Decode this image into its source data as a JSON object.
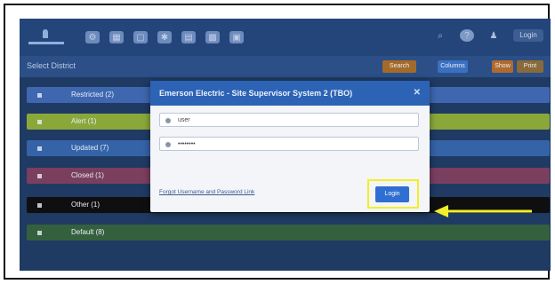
{
  "topbar": {
    "user_label": "Login"
  },
  "subbar": {
    "title": "Select District",
    "buttons": [
      "Search",
      "Columns",
      "Show",
      "Print"
    ]
  },
  "rows": [
    {
      "label": "Restricted (2)",
      "color": "#3e67b0"
    },
    {
      "label": "Alert (1)",
      "color": "#8aa83a"
    },
    {
      "label": "Updated (7)",
      "color": "#3563a8"
    },
    {
      "label": "Closed (1)",
      "color": "#7a3f5f"
    },
    {
      "label": "Other (1)",
      "color": "#0f0f10"
    },
    {
      "label": "Default (8)",
      "color": "#35603d"
    }
  ],
  "modal": {
    "title": "Emerson Electric - Site Supervisor System 2 (TBO)",
    "username_value": "user",
    "password_value": "••••••••",
    "forgot_label": "Forgot Username and Password Link",
    "login_label": "Login"
  },
  "colors": {
    "highlight": "#f2ee2a",
    "accent": "#2f6fd2"
  }
}
